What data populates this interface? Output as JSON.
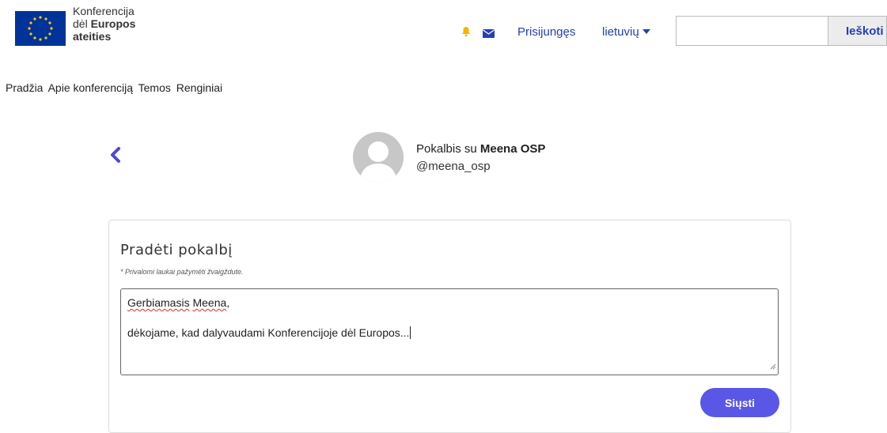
{
  "header": {
    "logo": {
      "line1": "Konferencija",
      "line2_prefix": "dėl ",
      "line2_bold": "Europos",
      "line3": "ateities"
    },
    "icons": [
      "bell-icon",
      "mail-icon"
    ],
    "login_label": "Prisijungęs",
    "language_label": "lietuvių",
    "search": {
      "placeholder": "",
      "button_label": "Ieškoti"
    }
  },
  "nav": {
    "items": [
      {
        "label": "Pradžia"
      },
      {
        "label": "Apie konferenciją"
      },
      {
        "label": "Temos"
      },
      {
        "label": "Renginiai"
      }
    ]
  },
  "conversation": {
    "title_prefix": "Pokalbis su ",
    "name": "Meena OSP",
    "handle": "@meena_osp"
  },
  "form": {
    "title": "Pradėti pokalbį",
    "required_note": "* Privalomi laukai pažymėti žvaigždute.",
    "message": {
      "greeting_word1": "Gerbiamasis",
      "greeting_word2": "Meena",
      "greeting_punct": ",",
      "body": "dėkojame, kad dalyvaudami Konferencijoje dėl Europos..."
    },
    "send_label": "Siųsti"
  },
  "colors": {
    "accent": "#2340b5",
    "button": "#5a57e6",
    "bell": "#f5b400",
    "eu_blue": "#003399",
    "eu_yellow": "#ffcc00"
  }
}
